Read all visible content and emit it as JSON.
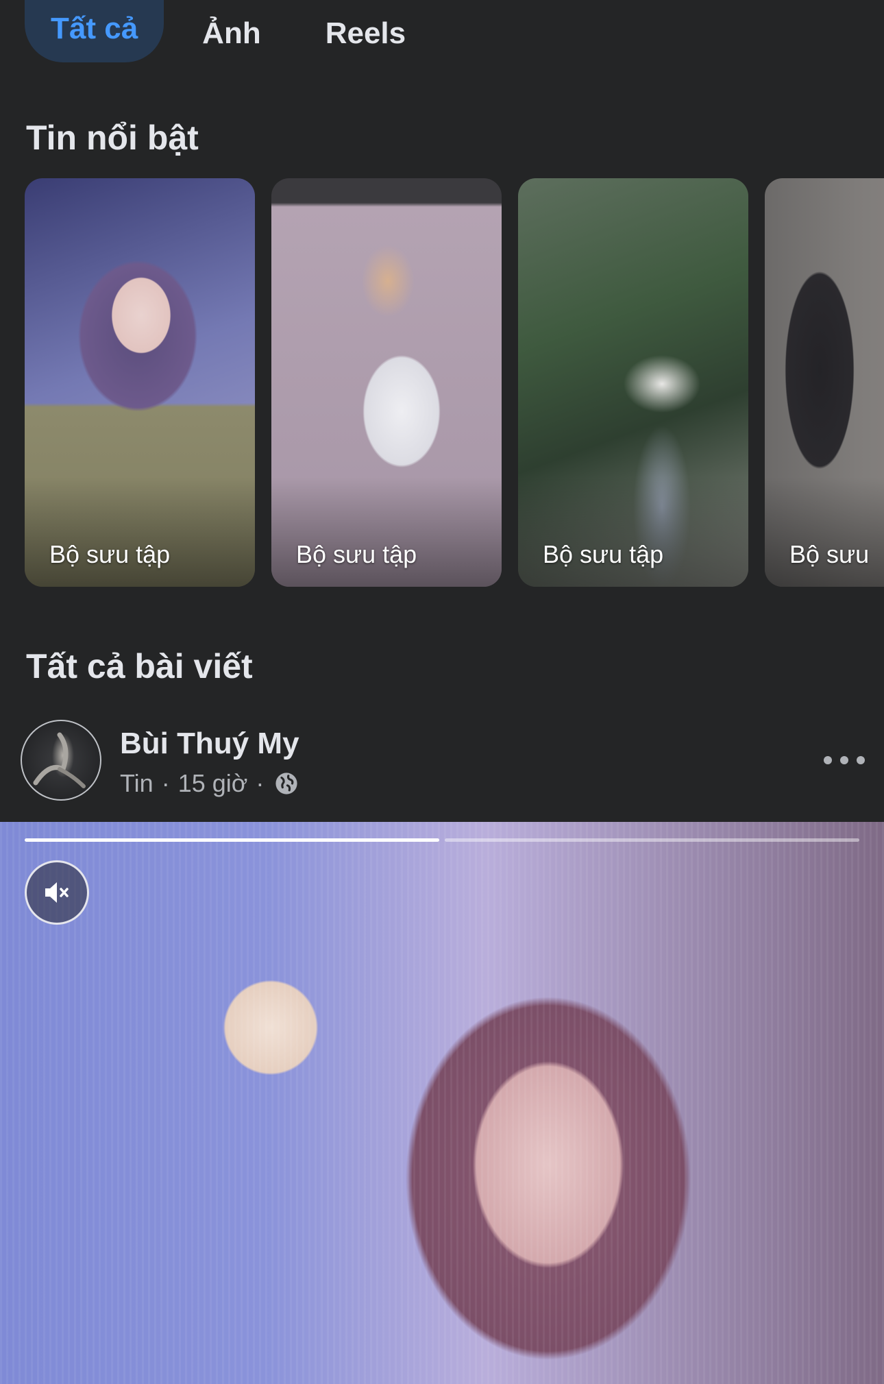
{
  "tabs": [
    {
      "label": "Tất cả",
      "active": true
    },
    {
      "label": "Ảnh",
      "active": false
    },
    {
      "label": "Reels",
      "active": false
    }
  ],
  "highlights": {
    "title": "Tin nổi bật",
    "items": [
      {
        "label": "Bộ sưu tập"
      },
      {
        "label": "Bộ sưu tập"
      },
      {
        "label": "Bộ sưu tập"
      },
      {
        "label": "Bộ sưu"
      }
    ]
  },
  "posts": {
    "title": "Tất cả bài viết",
    "post": {
      "author": "Bùi Thuý My",
      "type": "Tin",
      "separator": "·",
      "time": "15 giờ",
      "privacy_icon": "globe-icon",
      "more_icon": "more-horizontal-icon",
      "story": {
        "segments": [
          {
            "progress": 1.0
          },
          {
            "progress": 0.0
          }
        ],
        "mute_icon": "speaker-muted-icon",
        "muted": true
      }
    }
  },
  "colors": {
    "background": "#242526",
    "active_tab_bg": "#263951",
    "active_tab_text": "#4599ff",
    "primary_text": "#e4e6eb",
    "secondary_text": "#b0b3b8"
  }
}
